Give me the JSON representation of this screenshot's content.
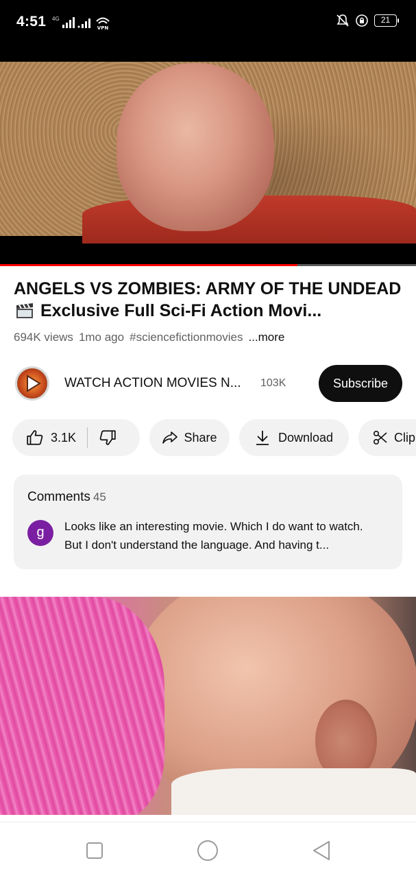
{
  "status_bar": {
    "time": "4:51",
    "network": "4G",
    "vpn": "VPN",
    "battery": "21"
  },
  "player": {
    "progress_fraction": 0.715
  },
  "video": {
    "title_part1": "ANGELS VS ZOMBIES: ARMY OF THE UNDEAD",
    "title_part2": "Exclusive Full Sci-Fi Action Movi...",
    "views": "694K views",
    "age": "1mo ago",
    "hashtag": "#sciencefictionmovies",
    "more": "...more"
  },
  "channel": {
    "name": "WATCH ACTION MOVIES N...",
    "subscribers": "103K",
    "subscribe_label": "Subscribe"
  },
  "actions": {
    "like_count": "3.1K",
    "share_label": "Share",
    "download_label": "Download",
    "clip_label": "Clip"
  },
  "comments": {
    "header": "Comments",
    "count": "45",
    "avatar_letter": "g",
    "text": "Looks like an interesting movie. Which I do want to watch. But I don't understand the language. And having t..."
  },
  "colors": {
    "progress": "#ff0000",
    "subscribe_bg": "#0f0f0f",
    "avatar_bg": "#7b1fa2"
  }
}
